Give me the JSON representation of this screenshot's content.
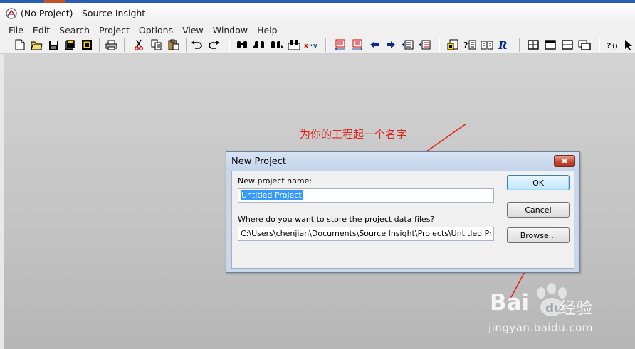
{
  "window": {
    "title": "(No Project) - Source Insight"
  },
  "menu": [
    "File",
    "Edit",
    "Search",
    "Project",
    "Options",
    "View",
    "Window",
    "Help"
  ],
  "annotation": {
    "text": "为你的工程起一个名字",
    "color": "#e2231a"
  },
  "dialog": {
    "title": "New Project",
    "name_label": "New project name:",
    "name_value": "Untitled Project",
    "location_label": "Where do you want to store the project data files?",
    "location_value": "C:\\Users\\chenjian\\Documents\\Source Insight\\Projects\\Untitled Project",
    "ok_label": "OK",
    "cancel_label": "Cancel",
    "browse_label": "Browse..."
  },
  "watermark": {
    "brand": "Bai",
    "brand_cn": "经验",
    "url": "jingyan.baidu.com"
  },
  "toolbar_icons": [
    "new-file-icon",
    "open-folder-icon",
    "save-icon",
    "save-all-icon",
    "close-file-icon",
    "print-icon",
    "cut-icon",
    "copy-icon",
    "paste-icon",
    "undo-icon",
    "redo-icon",
    "find-icon",
    "find-prev-icon",
    "find-next-icon",
    "search-files-icon",
    "replace-icon",
    "go-back-mark-icon",
    "go-forward-mark-icon",
    "back-arrow-icon",
    "forward-arrow-icon",
    "jump-to-definition-icon",
    "jump-to-caller-icon",
    "lookup-reference-icon",
    "symbol-info-icon",
    "browse-book-icon",
    "relation-icon",
    "layout-one-icon",
    "layout-two-icon",
    "layout-three-icon",
    "cascade-windows-icon",
    "context-help-icon",
    "pointer-icon"
  ]
}
